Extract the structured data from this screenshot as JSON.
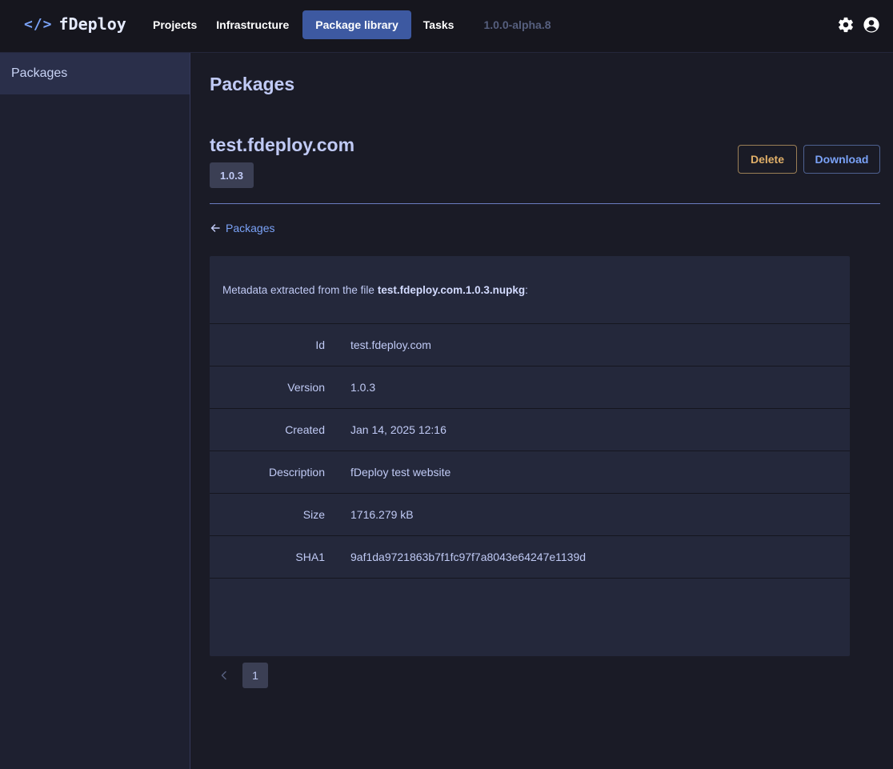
{
  "app": {
    "logo_glyph": "</>",
    "name": "fDeploy",
    "version": "1.0.0-alpha.8",
    "accent": "#7aa2f7"
  },
  "nav": {
    "items": [
      {
        "label": "Projects",
        "active": false
      },
      {
        "label": "Infrastructure",
        "active": false
      },
      {
        "label": "Package library",
        "active": true
      },
      {
        "label": "Tasks",
        "active": false
      }
    ],
    "icons": [
      "gear-icon",
      "user-circle-icon"
    ]
  },
  "sidebar": {
    "items": [
      {
        "label": "Packages",
        "active": true
      }
    ]
  },
  "page": {
    "title": "Packages",
    "package_name": "test.fdeploy.com",
    "version_badge": "1.0.3",
    "actions": {
      "delete_label": "Delete",
      "download_label": "Download"
    },
    "back_link": "Packages"
  },
  "metadata": {
    "intro": "Metadata extracted from the file",
    "filename": "test.fdeploy.com.1.0.3.nupkg",
    "suffix": ":",
    "rows": [
      {
        "key": "Id",
        "value": "test.fdeploy.com"
      },
      {
        "key": "Version",
        "value": "1.0.3"
      },
      {
        "key": "Created",
        "value": "Jan 14, 2025 12:16"
      },
      {
        "key": "Description",
        "value": "fDeploy test website"
      },
      {
        "key": "Size",
        "value": "1716.279 kB"
      },
      {
        "key": "SHA1",
        "value": "9af1da9721863b7f1fc97f7a8043e64247e1139d"
      }
    ]
  },
  "pagination": {
    "current_page": "1"
  }
}
